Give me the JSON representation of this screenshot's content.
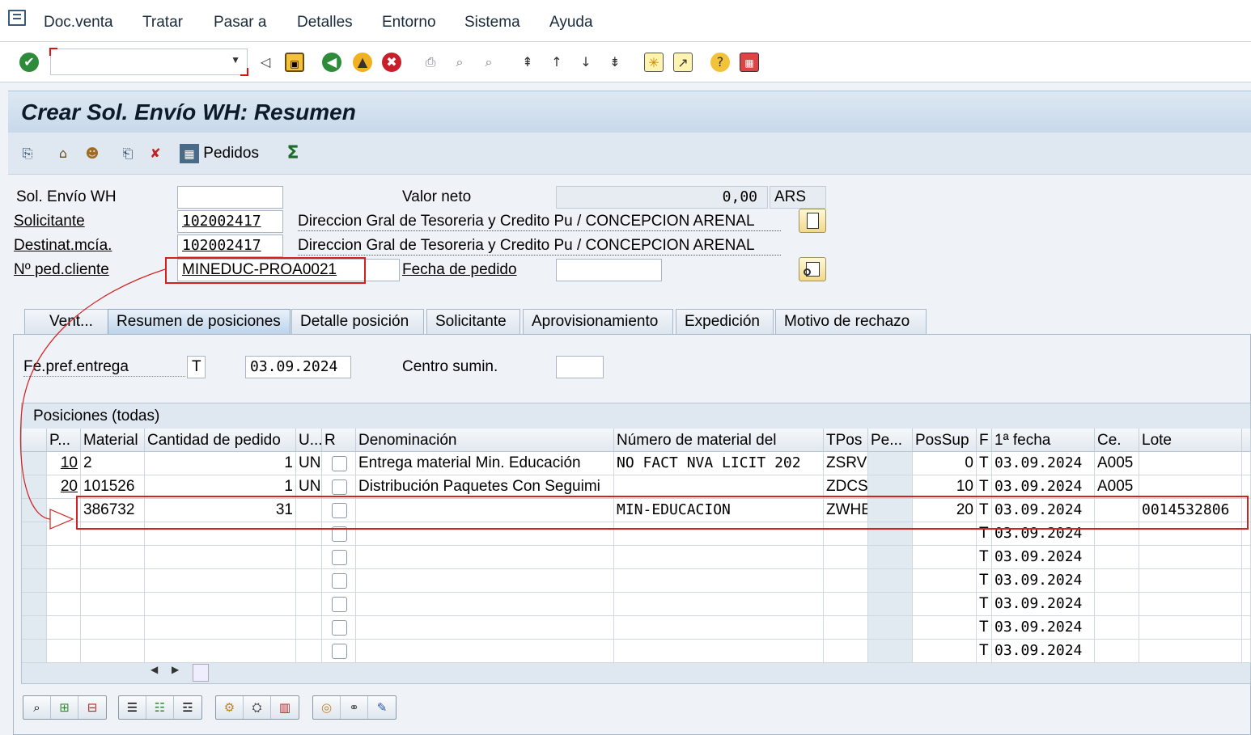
{
  "menu": {
    "items": [
      "Doc.venta",
      "Tratar",
      "Pasar a",
      "Detalles",
      "Entorno",
      "Sistema",
      "Ayuda"
    ]
  },
  "toolbar": {
    "command_value": ""
  },
  "screen": {
    "title": "Crear Sol. Envío WH: Resumen"
  },
  "app_toolbar": {
    "orders_label": "Pedidos"
  },
  "header": {
    "sol_envio_label": "Sol. Envío WH",
    "sol_envio_value": "",
    "valor_neto_label": "Valor neto",
    "valor_neto_value": "0,00",
    "currency": "ARS",
    "solicitante_label": "Solicitante",
    "solicitante_value": "102002417",
    "solicitante_name": "Direccion Gral de Tesoreria y Credito Pu / CONCEPCION ARENAL",
    "destinat_label": "Destinat.mcía.",
    "destinat_value": "102002417",
    "destinat_name": "Direccion Gral de Tesoreria y Credito Pu / CONCEPCION ARENAL",
    "ped_cliente_label": "Nº ped.cliente",
    "ped_cliente_value": "MINEDUC-PROA0021",
    "fecha_pedido_label": "Fecha de pedido",
    "fecha_pedido_value": ""
  },
  "tabs": [
    "Vent...",
    "Resumen de posiciones",
    "Detalle posición",
    "Solicitante",
    "Aprovisionamiento",
    "Expedición",
    "Motivo de rechazo"
  ],
  "active_tab": "Resumen de posiciones",
  "panel": {
    "fe_pref_label": "Fe.pref.entrega",
    "fe_pref_type": "T",
    "fe_pref_value": "03.09.2024",
    "centro_label": "Centro sumin.",
    "centro_value": ""
  },
  "table": {
    "title": "Posiciones (todas)",
    "columns": [
      "P...",
      "Material",
      "Cantidad de pedido",
      "U...",
      "R",
      "Denominación",
      "Número de material del",
      "TPos",
      "Pe...",
      "PosSup",
      "F",
      "1ª fecha",
      "Ce.",
      "Lote"
    ],
    "rows": [
      {
        "pos": "10",
        "material": "2",
        "qty": "1",
        "unit": "UN",
        "desc": "Entrega material Min. Educación",
        "cust_mat": "NO FACT NVA LICIT 202",
        "tpos": "ZSRV",
        "pe": "",
        "possup": "0",
        "f": "T",
        "date": "03.09.2024",
        "ce": "A005",
        "lote": ""
      },
      {
        "pos": "20",
        "material": "101526",
        "qty": "1",
        "unit": "UN",
        "desc": "Distribución Paquetes Con Seguimi",
        "cust_mat": "",
        "tpos": "ZDCS",
        "pe": "",
        "possup": "10",
        "f": "T",
        "date": "03.09.2024",
        "ce": "A005",
        "lote": ""
      },
      {
        "pos": "",
        "material": "386732",
        "qty": "31",
        "unit": "",
        "desc": "",
        "cust_mat": "MIN-EDUCACION",
        "tpos": "ZWHE",
        "pe": "",
        "possup": "20",
        "f": "T",
        "date": "03.09.2024",
        "ce": "",
        "lote": "0014532806"
      },
      {
        "pos": "",
        "material": "",
        "qty": "",
        "unit": "",
        "desc": "",
        "cust_mat": "",
        "tpos": "",
        "pe": "",
        "possup": "",
        "f": "T",
        "date": "03.09.2024",
        "ce": "",
        "lote": ""
      },
      {
        "pos": "",
        "material": "",
        "qty": "",
        "unit": "",
        "desc": "",
        "cust_mat": "",
        "tpos": "",
        "pe": "",
        "possup": "",
        "f": "T",
        "date": "03.09.2024",
        "ce": "",
        "lote": ""
      },
      {
        "pos": "",
        "material": "",
        "qty": "",
        "unit": "",
        "desc": "",
        "cust_mat": "",
        "tpos": "",
        "pe": "",
        "possup": "",
        "f": "T",
        "date": "03.09.2024",
        "ce": "",
        "lote": ""
      },
      {
        "pos": "",
        "material": "",
        "qty": "",
        "unit": "",
        "desc": "",
        "cust_mat": "",
        "tpos": "",
        "pe": "",
        "possup": "",
        "f": "T",
        "date": "03.09.2024",
        "ce": "",
        "lote": ""
      },
      {
        "pos": "",
        "material": "",
        "qty": "",
        "unit": "",
        "desc": "",
        "cust_mat": "",
        "tpos": "",
        "pe": "",
        "possup": "",
        "f": "T",
        "date": "03.09.2024",
        "ce": "",
        "lote": ""
      },
      {
        "pos": "",
        "material": "",
        "qty": "",
        "unit": "",
        "desc": "",
        "cust_mat": "",
        "tpos": "",
        "pe": "",
        "possup": "",
        "f": "T",
        "date": "03.09.2024",
        "ce": "",
        "lote": ""
      }
    ]
  },
  "colors": {
    "highlight": "#d32121",
    "title_bg": "#c8d9ea",
    "selection": "#dfe8f1"
  }
}
